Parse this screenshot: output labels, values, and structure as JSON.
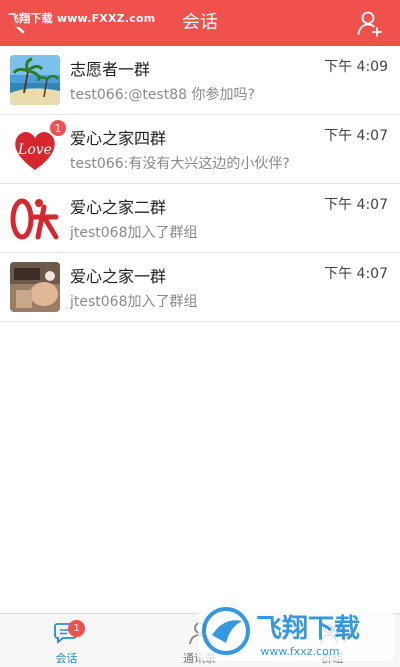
{
  "header": {
    "title": "会话",
    "watermark": "飞翔下载 www.FXXZ.com",
    "accent": "#f0514d"
  },
  "conversations": [
    {
      "name": "志愿者一群",
      "time": "下午 4:09",
      "preview": "test066:@test88 你参加吗?",
      "unread": "",
      "avatar": "beach-photo"
    },
    {
      "name": "爱心之家四群",
      "time": "下午 4:07",
      "preview": "test066:有没有大兴这边的小伙伴?",
      "unread": "1",
      "avatar": "love-heart-logo"
    },
    {
      "name": "爱心之家二群",
      "time": "下午 4:07",
      "preview": "jtest068加入了群组",
      "unread": "",
      "avatar": "red-logo"
    },
    {
      "name": "爱心之家一群",
      "time": "下午 4:07",
      "preview": "jtest068加入了群组",
      "unread": "",
      "avatar": "photo"
    }
  ],
  "tabbar": {
    "tabs": [
      {
        "label": "会话",
        "badge": "1",
        "icon": "chat-icon"
      },
      {
        "label": "通讯录",
        "icon": "contacts-icon"
      },
      {
        "label": "群组",
        "icon": "group-icon"
      }
    ],
    "logo_text": "飞翔下载",
    "logo_url": "www.fxxz.com"
  }
}
